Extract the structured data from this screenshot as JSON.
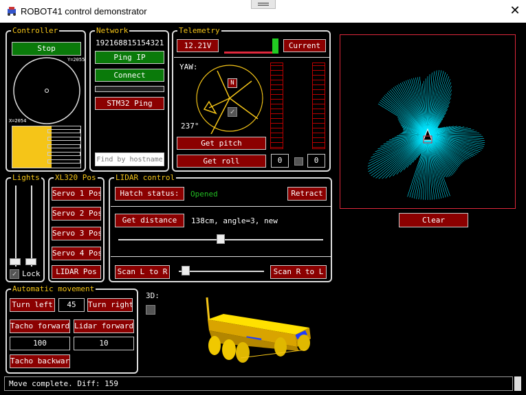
{
  "window": {
    "title": "ROBOT41 control demonstrator",
    "close": "✕",
    "icon": "robot-app-icon"
  },
  "controller": {
    "legend": "Controller",
    "stop_label": "Stop",
    "y_readout": "Y=2055",
    "x_readout": "X=2054",
    "level": 0.58
  },
  "network": {
    "legend": "Network",
    "address": "192168815154321",
    "ping_ip": "Ping IP",
    "connect": "Connect",
    "stm32_ping": "STM32 Ping",
    "find_placeholder": "Find by hostname"
  },
  "telemetry": {
    "legend": "Telemetry",
    "voltage": "12.21V",
    "current": "Current",
    "current_level": 0.75,
    "yaw_label": "YAW:",
    "north": "N",
    "heading": "237°",
    "get_pitch": "Get pitch",
    "get_roll": "Get roll",
    "pitch_value": "0",
    "roll_value": "0"
  },
  "lidar_view": {
    "clear": "Clear"
  },
  "lights": {
    "legend": "Lights",
    "lock": "Lock",
    "lock_checked": true
  },
  "xl320": {
    "legend": "XL320 Pos",
    "buttons": [
      "Servo 1 Pos",
      "Servo 2 Pos",
      "Servo 3 Pos",
      "Servo 4 Pos",
      "LIDAR Pos"
    ]
  },
  "lidar_control": {
    "legend": "LIDAR control",
    "hatch_status": "Hatch status:",
    "hatch_value": "Opened",
    "retract": "Retract",
    "get_distance": "Get distance",
    "distance_text": "138cm, angle=3, new",
    "angle_slider": 0.5,
    "scan_l_to_r": "Scan L to R",
    "scan_r_to_l": "Scan R to L",
    "scan_slider": 0.04
  },
  "automatic": {
    "legend": "Automatic movement",
    "turn_left": "Turn left",
    "angle_value": "45",
    "turn_right": "Turn right",
    "tacho_forward": "Tacho forward",
    "lidar_forward": "Lidar forward",
    "tacho_value": "100",
    "lidar_value": "10",
    "tacho_backward": "Tacho backward"
  },
  "view3d": {
    "label": "3D:"
  },
  "status": {
    "text": "Move complete. Diff: 159"
  },
  "colors": {
    "accent": "#f5c518",
    "button_red": "#8b0000",
    "button_green": "#0a7a0a",
    "lidar": "#00e5ff",
    "status_green": "#22bb22"
  }
}
